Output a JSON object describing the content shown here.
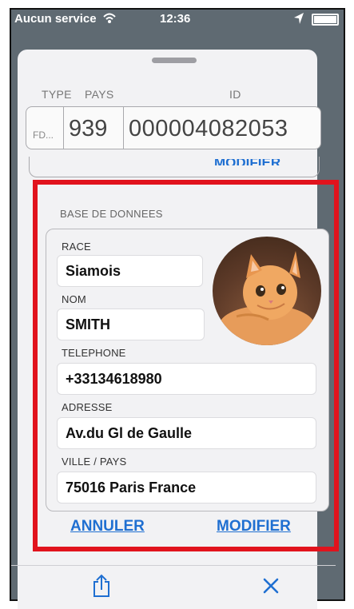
{
  "status_bar": {
    "carrier": "Aucun service",
    "time": "12:36"
  },
  "id_card": {
    "columns": {
      "type": "TYPE",
      "country": "PAYS",
      "id": "ID"
    },
    "type_value": "FD...",
    "country_value": "939",
    "id_value": "000004082053",
    "hidden_link": "MODIFIER"
  },
  "database": {
    "title": "BASE DE DONNEES",
    "fields": {
      "race": {
        "label": "RACE",
        "value": "Siamois"
      },
      "name": {
        "label": "NOM",
        "value": "SMITH"
      },
      "phone": {
        "label": "TELEPHONE",
        "value": "+33134618980"
      },
      "address": {
        "label": "ADRESSE",
        "value": "Av.du Gl de Gaulle"
      },
      "city": {
        "label": "VILLE / PAYS",
        "value": "75016 Paris France"
      }
    },
    "avatar_icon": "kitten-photo"
  },
  "actions": {
    "cancel": "ANNULER",
    "edit": "MODIFIER"
  },
  "toolbar": {
    "share_icon": "share-icon",
    "close_icon": "close-icon"
  },
  "colors": {
    "accent": "#1f6fd1",
    "highlight": "#e1131d"
  }
}
